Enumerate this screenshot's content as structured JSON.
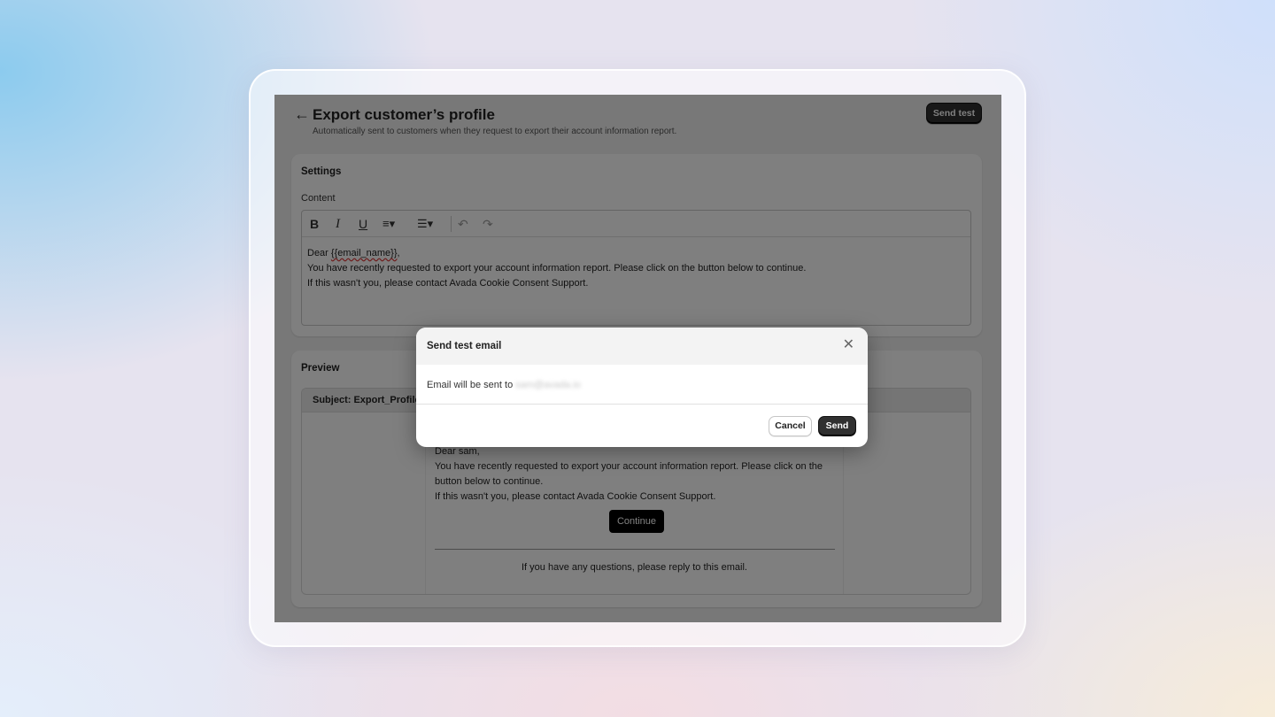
{
  "page": {
    "back_icon": "arrow-left-icon",
    "title": "Export customer’s profile",
    "subtitle": "Automatically sent to customers when they request to export their account information report.",
    "send_test_label": "Send test"
  },
  "settings": {
    "title": "Settings",
    "content_label": "Content",
    "toolbar": {
      "bold": "B",
      "italic": "I",
      "underline": "U",
      "align": "≡▾",
      "insert": "☰▾",
      "undo": "↶",
      "redo": "↷"
    },
    "editor_lines": {
      "line1_prefix": "Dear ",
      "line1_variable": "{{email_name}}",
      "line1_suffix": ",",
      "line2": "You have recently requested to export your account information report. Please click on the button below to continue.",
      "line3": "If this wasn't you, please contact Avada Cookie Consent Support."
    }
  },
  "preview": {
    "title": "Preview",
    "subject": "Subject: Export_Profile_",
    "greeting": "Dear sam,",
    "line1": "You have recently requested to export your account information report. Please click on the button below to continue.",
    "line2": "If this wasn't you, please contact Avada Cookie Consent Support.",
    "continue_label": "Continue",
    "footer": "If you have any questions, please reply to this email."
  },
  "modal": {
    "title": "Send test email",
    "close_icon": "close-icon",
    "body_prefix": "Email will be sent to",
    "email_hidden": "sam@avada.io",
    "cancel_label": "Cancel",
    "send_label": "Send"
  }
}
